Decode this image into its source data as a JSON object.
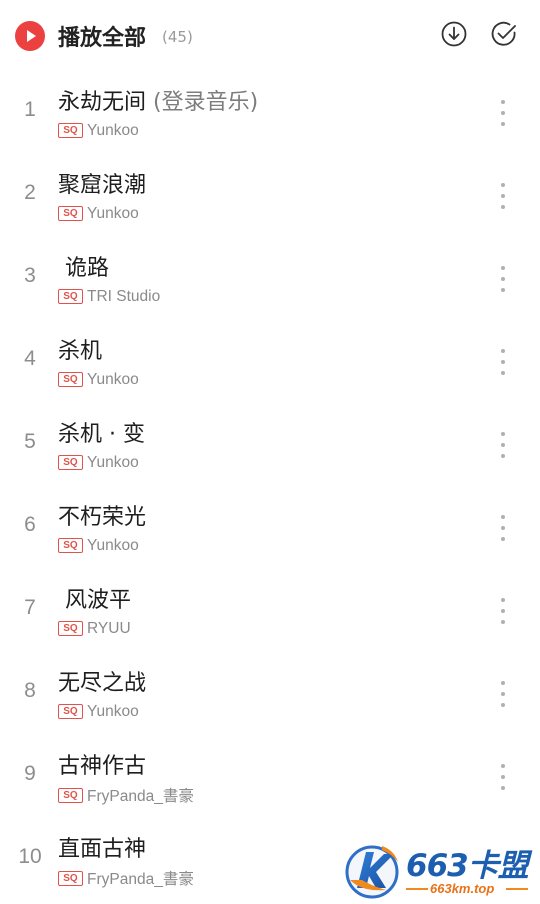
{
  "header": {
    "title": "播放全部",
    "count": "(45)",
    "play_icon": "play-circle-icon",
    "download_icon": "download-icon",
    "multiselect_icon": "check-circle-icon"
  },
  "colors": {
    "accent": "#ec4141",
    "sq_badge": "#e0534a"
  },
  "songs": [
    {
      "num": "1",
      "title": "永劫无间",
      "extra": " (登录音乐)",
      "badge": "SQ",
      "artist": "Yunkoo"
    },
    {
      "num": "2",
      "title": "聚窟浪潮",
      "extra": "",
      "badge": "SQ",
      "artist": "Yunkoo"
    },
    {
      "num": "3",
      "title": " 诡路",
      "extra": "",
      "badge": "SQ",
      "artist": "TRI Studio"
    },
    {
      "num": "4",
      "title": "杀机",
      "extra": "",
      "badge": "SQ",
      "artist": "Yunkoo"
    },
    {
      "num": "5",
      "title": "杀机 · 变",
      "extra": "",
      "badge": "SQ",
      "artist": "Yunkoo"
    },
    {
      "num": "6",
      "title": "不朽荣光",
      "extra": "",
      "badge": "SQ",
      "artist": "Yunkoo"
    },
    {
      "num": "7",
      "title": " 风波平",
      "extra": "",
      "badge": "SQ",
      "artist": "RYUU"
    },
    {
      "num": "8",
      "title": "无尽之战",
      "extra": "",
      "badge": "SQ",
      "artist": "Yunkoo"
    },
    {
      "num": "9",
      "title": "古神作古",
      "extra": "",
      "badge": "SQ",
      "artist": "FryPanda_書豪"
    },
    {
      "num": "10",
      "title": "直面古神",
      "extra": "",
      "badge": "SQ",
      "artist": "FryPanda_書豪"
    }
  ],
  "watermark": {
    "title": "663卡盟",
    "url": "663km.top"
  }
}
